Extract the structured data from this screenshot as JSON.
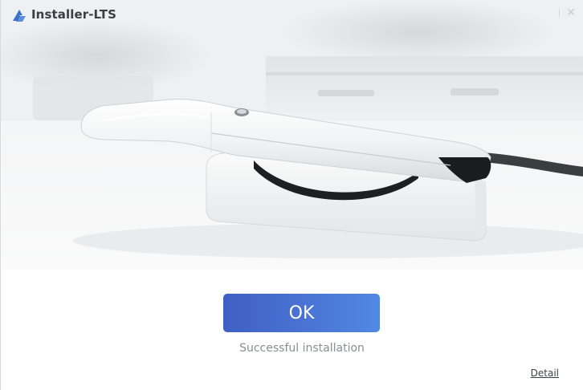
{
  "window": {
    "title": "Installer-LTS",
    "logo_icon": "installer-logo-icon",
    "close_glyph": "✕"
  },
  "hero": {
    "image": "intraoral-scanner-product-photo"
  },
  "actions": {
    "ok_label": "OK",
    "detail_label": "Detail"
  },
  "status": {
    "message": "Successful installation"
  },
  "colors": {
    "accent_start": "#3f5fc4",
    "accent_end": "#5089e2",
    "title_text": "#3a3f47",
    "status_text": "#8a8d92",
    "logo_blue": "#3b73c9"
  }
}
